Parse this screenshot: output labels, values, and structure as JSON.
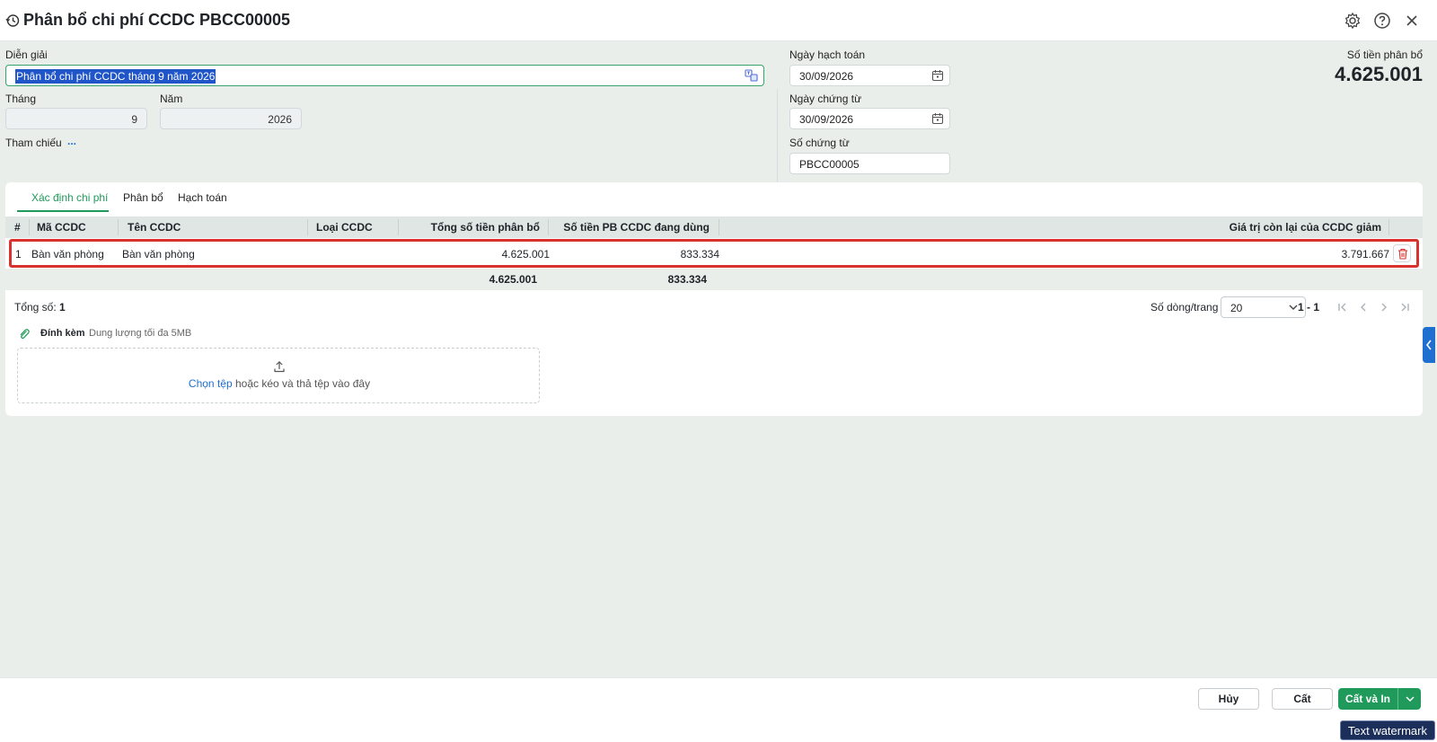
{
  "header": {
    "title": "Phân bổ chi phí CCDC PBCC00005",
    "icons": [
      "history-icon",
      "gear-icon",
      "help-icon",
      "close-icon"
    ]
  },
  "form": {
    "dien_giai_label": "Diễn giải",
    "dien_giai_value": "Phân bổ chi phí CCDC tháng 9 năm 2026",
    "thang_label": "Tháng",
    "thang_value": "9",
    "nam_label": "Năm",
    "nam_value": "2026",
    "tham_chieu_label": "Tham chiếu",
    "tham_chieu_link": "...",
    "ngay_hach_toan_label": "Ngày hạch toán",
    "ngay_hach_toan_value": "30/09/2026",
    "ngay_chung_tu_label": "Ngày chứng từ",
    "ngay_chung_tu_value": "30/09/2026",
    "so_chung_tu_label": "Số chứng từ",
    "so_chung_tu_value": "PBCC00005",
    "so_tien_label": "Số tiền phân bổ",
    "so_tien_value": "4.625.001"
  },
  "tabs": [
    {
      "label": "Xác định chi phí",
      "active": true
    },
    {
      "label": "Phân bổ",
      "active": false
    },
    {
      "label": "Hạch toán",
      "active": false
    }
  ],
  "grid": {
    "columns": [
      "#",
      "Mã CCDC",
      "Tên CCDC",
      "Loại CCDC",
      "Tổng số tiền phân bổ",
      "Số tiền PB CCDC đang dùng",
      "Giá trị còn lại của CCDC giảm"
    ],
    "rows": [
      {
        "no": "1",
        "ma": "Bàn văn phòng",
        "ten": "Bàn văn phòng",
        "loai": "",
        "tong": "4.625.001",
        "dang_dung": "833.334",
        "con_lai": "3.791.667"
      }
    ],
    "totals": {
      "tong": "4.625.001",
      "dang_dung": "833.334"
    }
  },
  "pager": {
    "total_label": "Tổng số:",
    "total_value": "1",
    "rows_label": "Số dòng/trang",
    "rows_value": "20",
    "range": "1 - 1"
  },
  "attach": {
    "label": "Đính kèm",
    "sub": "Dung lượng tối đa 5MB",
    "choose_link": "Chọn tệp",
    "drop_text": "hoặc kéo và thả tệp vào đây"
  },
  "buttons": {
    "cancel": "Hủy",
    "save": "Cất",
    "save_print": "Cất và In"
  },
  "watermark": "Text watermark",
  "colors": {
    "accent": "#1f9a5a",
    "link": "#1f6fd1",
    "highlight_border": "#d9312d",
    "background": "#e9eeeb"
  }
}
